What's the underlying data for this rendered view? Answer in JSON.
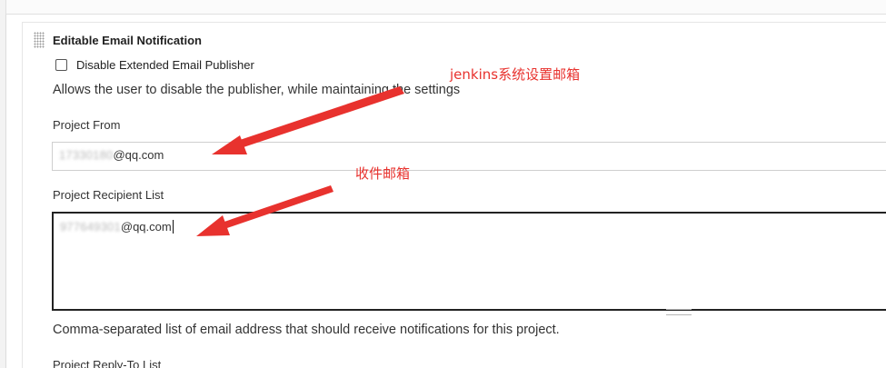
{
  "section": {
    "title": "Editable Email Notification"
  },
  "disable_publisher": {
    "label": "Disable Extended Email Publisher",
    "checked": false,
    "help": "Allows the user to disable the publisher, while maintaining the settings"
  },
  "project_from": {
    "label": "Project From",
    "value_visible": "@qq.com",
    "value_obscured": "17330180"
  },
  "recipient_list": {
    "label": "Project Recipient List",
    "value_visible": "@qq.com",
    "value_obscured": "977649301",
    "help": "Comma-separated list of email address that should receive notifications for this project."
  },
  "reply_to": {
    "label": "Project Reply-To List"
  },
  "annotations": {
    "sender_note": "jenkins系统设置邮箱",
    "recipient_note": "收件邮箱",
    "color": "#e8322e"
  },
  "icons": {
    "drag_handle": "drag-handle-icon"
  }
}
